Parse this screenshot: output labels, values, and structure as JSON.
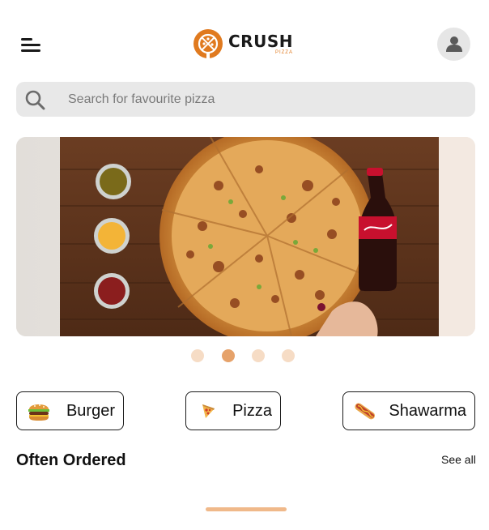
{
  "header": {
    "menu_icon": "hamburger-menu-icon",
    "logo": {
      "name": "CRUSH",
      "sub": "PIZZA",
      "brand_color": "#e07a1f"
    },
    "profile_icon": "user-icon"
  },
  "search": {
    "placeholder": "Search for favourite pizza",
    "icon": "search-icon"
  },
  "banner": {
    "image": "pizza with dipping sauces and cola bottle"
  },
  "carousel": {
    "dots": 4,
    "active_index": 1,
    "dot_color": "#f6dcc5",
    "active_color": "#e6a26a"
  },
  "categories": [
    {
      "label": "Burger",
      "icon": "burger-icon"
    },
    {
      "label": "Pizza",
      "icon": "pizza-icon"
    },
    {
      "label": "Shawarma",
      "icon": "hotdog-icon"
    }
  ],
  "section": {
    "title": "Often Ordered",
    "see_all": "See all"
  }
}
